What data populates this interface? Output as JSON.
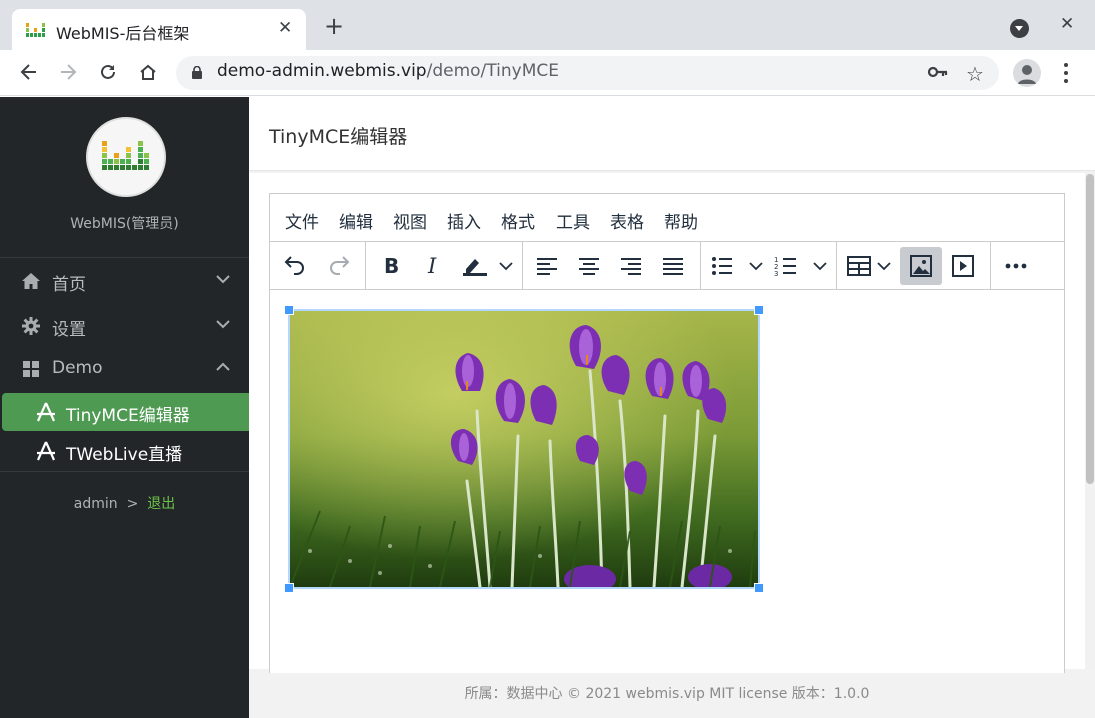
{
  "browser": {
    "tab_title": "WebMIS-后台框架",
    "url_host": "demo-admin.webmis.vip",
    "url_path": "/demo/TinyMCE"
  },
  "sidebar": {
    "role": "WebMIS(管理员)",
    "menu": [
      {
        "label": "首页",
        "icon": "home-icon"
      },
      {
        "label": "设置",
        "icon": "gear-icon"
      },
      {
        "label": "Demo",
        "icon": "grid-icon"
      }
    ],
    "submenu": [
      {
        "label": "TinyMCE编辑器",
        "active": true
      },
      {
        "label": "TWebLive直播",
        "active": false
      }
    ],
    "user": "admin",
    "separator": ">",
    "logout": "退出"
  },
  "page": {
    "title": "TinyMCE编辑器"
  },
  "editor": {
    "menubar": [
      "文件",
      "编辑",
      "视图",
      "插入",
      "格式",
      "工具",
      "表格",
      "帮助"
    ],
    "toolbar_icons": [
      "undo-icon",
      "redo-icon",
      "bold-icon",
      "italic-icon",
      "highlight-color-icon",
      "align-left-icon",
      "align-center-icon",
      "align-right-icon",
      "justify-icon",
      "bullet-list-icon",
      "numbered-list-icon",
      "table-icon",
      "image-icon",
      "media-icon",
      "more-icon"
    ],
    "active_tool": "image-icon",
    "image_subject": "purple crocus flowers in grass"
  },
  "footer": {
    "text": "所属：数据中心 © 2021 webmis.vip MIT license 版本：1.0.0"
  },
  "colors": {
    "sidebar_bg": "#222629",
    "active_item": "#4e9a53",
    "logout_link": "#6cc24a",
    "selection_handle": "#4099ff"
  }
}
